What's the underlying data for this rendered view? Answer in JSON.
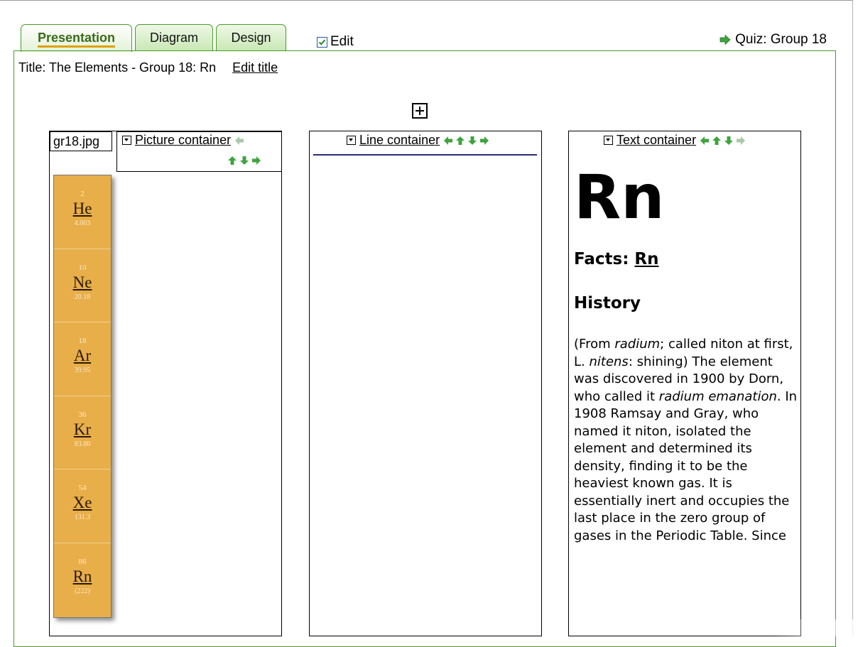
{
  "tabs": [
    {
      "label": "Presentation",
      "active": true
    },
    {
      "label": "Diagram",
      "active": false
    },
    {
      "label": "Design",
      "active": false
    }
  ],
  "edit_checkbox": {
    "label": "Edit",
    "checked": true
  },
  "quiz_link": {
    "label": "Quiz: Group 18",
    "icon": "green-right-arrow-icon"
  },
  "title_bar": {
    "text": "Title: The Elements - Group 18: Rn",
    "edit_link": "Edit title"
  },
  "add_button": {
    "icon": "plus-box-icon"
  },
  "picture_container": {
    "file_name": "gr18.jpg",
    "label": "Picture container",
    "arrows": [
      "left (disabled)",
      "up",
      "down",
      "right"
    ],
    "elements": [
      {
        "number": "2",
        "symbol": "He",
        "mass": "4.003"
      },
      {
        "number": "10",
        "symbol": "Ne",
        "mass": "20.18"
      },
      {
        "number": "18",
        "symbol": "Ar",
        "mass": "39.95"
      },
      {
        "number": "36",
        "symbol": "Kr",
        "mass": "83.80"
      },
      {
        "number": "54",
        "symbol": "Xe",
        "mass": "131.3"
      },
      {
        "number": "86",
        "symbol": "Rn",
        "mass": "(222)"
      }
    ]
  },
  "line_container": {
    "label": "Line container",
    "arrows": [
      "left",
      "up",
      "down",
      "right"
    ]
  },
  "text_container": {
    "label": "Text container",
    "arrows": [
      "left",
      "up",
      "down",
      "right (disabled)"
    ],
    "big_symbol": "Rn",
    "facts_prefix": "Facts: ",
    "facts_link": "Rn",
    "history_heading": "History",
    "history_parts": {
      "p1": "(From ",
      "i1": "radium",
      "p2": "; called niton at first, L. ",
      "i2": "nitens",
      "p3": ": shining) The element was discovered in 1900 by Dorn, who called it ",
      "i3": "radium emanation",
      "p4": ". In 1908 Ramsay and Gray, who named it niton, isolated the element and determined its density, finding it to be the heaviest known gas. It is essentially inert and occupies the last place in the zero group of gases in the Periodic Table. Since"
    }
  },
  "colors": {
    "tab_border": "#4a9a2a",
    "tab_active_text": "#3a6a1a",
    "element_tile": "#e8ae4a",
    "arrow_green": "#3fa33f",
    "arrow_disabled": "#a9c9a9"
  }
}
